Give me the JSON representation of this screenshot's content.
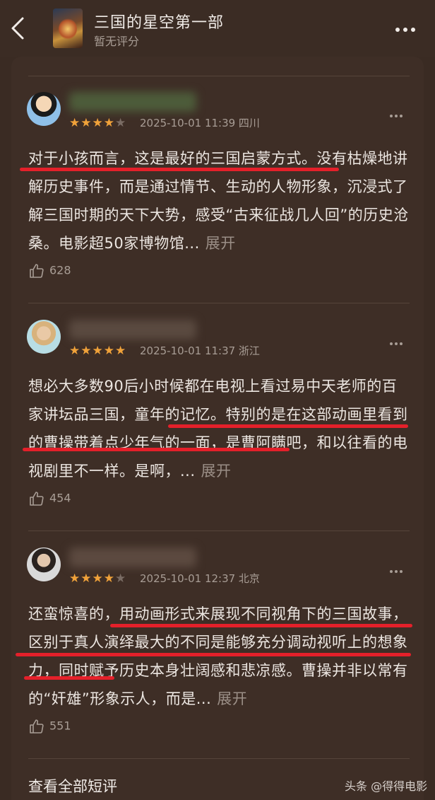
{
  "header": {
    "title": "三国的星空第一部",
    "rating_text": "暂无评分"
  },
  "reviews": [
    {
      "rating": 4,
      "stars_on": "★★★★",
      "stars_off": "★",
      "timestamp": "2025-10-01 11:39 四川",
      "text": "对于小孩而言，这是最好的三国启蒙方式。没有枯燥地讲解历史事件，而是通过情节、生动的人物形象，沉浸式了解三国时期的天下大势，感受“古来征战几人回”的历史沧桑。电影超50家博物馆...",
      "expand_label": "展开",
      "likes": "628"
    },
    {
      "rating": 5,
      "stars_on": "★★★★★",
      "stars_off": "",
      "timestamp": "2025-10-01 11:37 浙江",
      "text": "想必大多数90后小时候都在电视上看过易中天老师的百家讲坛品三国，童年的记忆。特别的是在这部动画里看到的曹操带着点少年气的一面，是曹阿瞒吧，和以往看的电视剧里不一样。是啊，...",
      "expand_label": "展开",
      "likes": "454"
    },
    {
      "rating": 4,
      "stars_on": "★★★★",
      "stars_off": "★",
      "timestamp": "2025-10-01 12:37 北京",
      "text": "还蛮惊喜的，用动画形式来展现不同视角下的三国故事，区别于真人演绎最大的不同是能够充分调动视听上的想象力，同时赋予历史本身壮阔感和悲凉感。曹操并非以常有的“奸雄”形象示人，而是...",
      "expand_label": "展开",
      "likes": "551"
    }
  ],
  "footer": {
    "view_all_label": "查看全部短评",
    "watermark": "头条 @得得电影"
  },
  "colors": {
    "background": "#3a2b23",
    "star": "#f0a23a",
    "underline": "#e4202a"
  },
  "icons": [
    "back-arrow-icon",
    "more-icon",
    "star-icon",
    "thumbs-up-icon"
  ]
}
